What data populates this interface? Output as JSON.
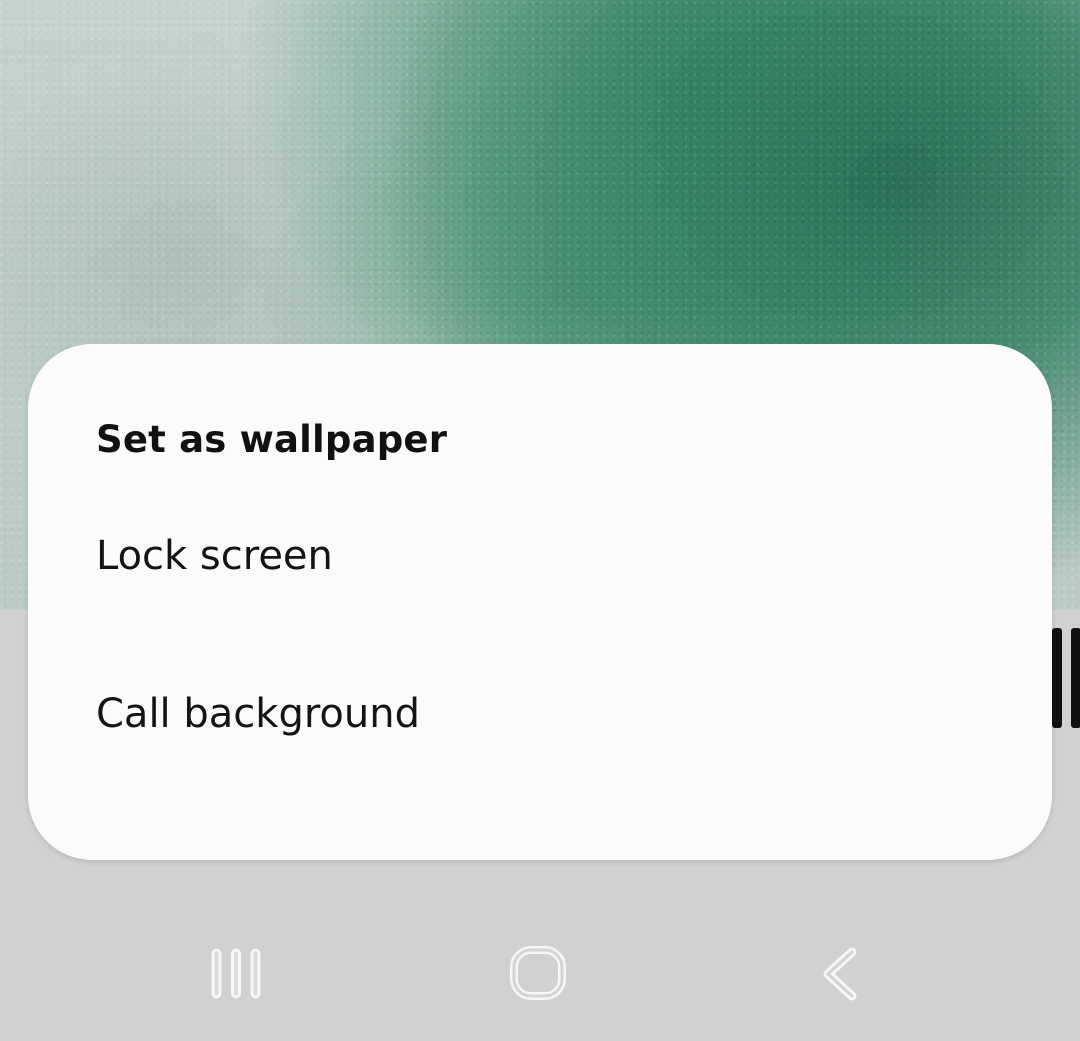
{
  "dialog": {
    "title": "Set as wallpaper",
    "options": [
      {
        "label": "Lock screen"
      },
      {
        "label": "Call background"
      }
    ]
  },
  "navbar": {
    "recents_icon": "recents-icon",
    "home_icon": "home-icon",
    "back_icon": "back-icon"
  },
  "colors": {
    "dialog_bg": "#fbfbfb",
    "scrim_bg": "#d1d1d1",
    "wallpaper_green": "#2f7d60",
    "text": "#141414",
    "nav_icon": "#f4f4f4"
  }
}
